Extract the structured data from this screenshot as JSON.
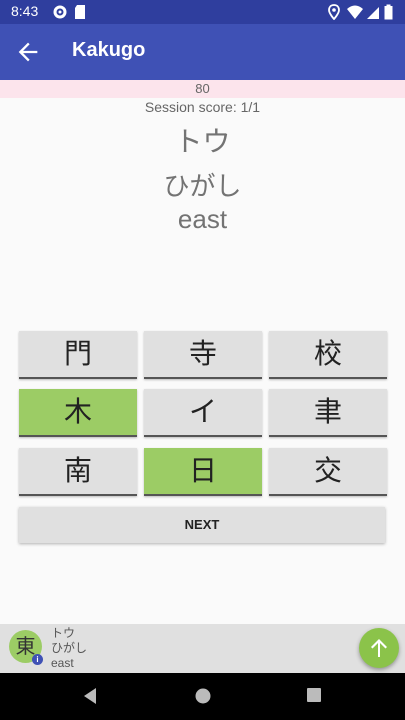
{
  "status_bar": {
    "time": "8:43",
    "icons": [
      "gear-icon",
      "sd-card-icon",
      "location-icon",
      "wifi-icon",
      "signal-icon",
      "battery-icon"
    ]
  },
  "toolbar": {
    "title": "Kakugo",
    "back_icon": "arrow-back-icon"
  },
  "progress": {
    "label": "80"
  },
  "session": {
    "score_label": "Session score: 1/1"
  },
  "question": {
    "kana": "トウ",
    "reading": "ひがし",
    "meaning": "east"
  },
  "answers": [
    {
      "kanji": "門",
      "state": "default"
    },
    {
      "kanji": "寺",
      "state": "default"
    },
    {
      "kanji": "校",
      "state": "default"
    },
    {
      "kanji": "木",
      "state": "correct"
    },
    {
      "kanji": "イ",
      "state": "default"
    },
    {
      "kanji": "聿",
      "state": "default"
    },
    {
      "kanji": "南",
      "state": "default"
    },
    {
      "kanji": "日",
      "state": "correct"
    },
    {
      "kanji": "交",
      "state": "default"
    }
  ],
  "next_button": {
    "label": "NEXT"
  },
  "info_bar": {
    "kanji": "東",
    "kana": "トウ",
    "reading": "ひがし",
    "meaning": "east",
    "info_badge": "i"
  },
  "colors": {
    "primary": "#3f51b5",
    "primary_dark": "#2f3e9e",
    "correct": "#9ccc65",
    "fab": "#8bc34a",
    "progress_bg": "#fce4ec"
  },
  "navigation": {
    "buttons": [
      "back-triangle-icon",
      "home-circle-icon",
      "recents-square-icon"
    ]
  }
}
